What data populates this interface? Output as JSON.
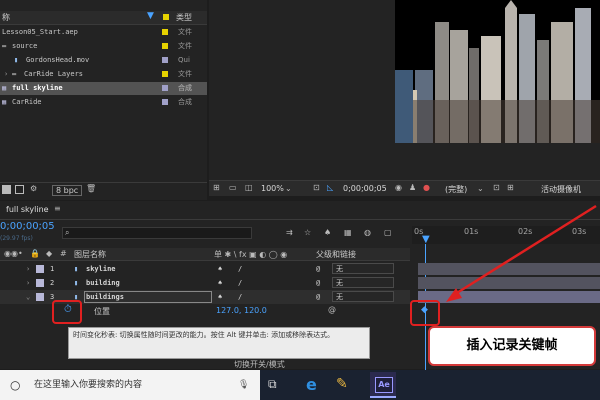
{
  "project": {
    "col_name": "称",
    "col_type": "类型",
    "items": [
      {
        "name": "Lesson05_Start.aep",
        "type": "文件",
        "label_color": "#e6d200",
        "indent": 0
      },
      {
        "name": "source",
        "type": "文件",
        "label_color": "#e6d200",
        "indent": 1
      },
      {
        "name": "GordonsHead.mov",
        "type": "Qui",
        "label_color": "#a0a0c8",
        "indent": 2
      },
      {
        "name": "CarRide Layers",
        "type": "文件",
        "label_color": "#e6d200",
        "indent": 1
      },
      {
        "name": "full skyline",
        "type": "合成",
        "label_color": "#a0a0c8",
        "indent": 0,
        "selected": true
      },
      {
        "name": "CarRide",
        "type": "合成",
        "label_color": "#a0a0c8",
        "indent": 0
      }
    ],
    "footer_bpc": "8 bpc"
  },
  "viewer": {
    "zoom": "100%",
    "timecode": "0;00;00;05",
    "quality": "(完整)",
    "camera": "活动摄像机"
  },
  "timeline": {
    "tab_label": "full skyline",
    "current_time": "0;00;00;05",
    "fps": "(29.97 fps)",
    "search_placeholder": "",
    "col_name": "图层名称",
    "col_switches": "单 ✱ \\ fx ▣ ◐ ◯ ◉",
    "col_parent": "父级和链接",
    "layers": [
      {
        "index": "1",
        "name": "skyline",
        "parent": "无"
      },
      {
        "index": "2",
        "name": "building",
        "parent": "无"
      },
      {
        "index": "3",
        "name": "buildings",
        "parent": "无"
      }
    ],
    "property_label": "位置",
    "property_value": "127.0, 120.0",
    "ruler_marks": [
      "0s",
      "01s",
      "02s",
      "03s"
    ],
    "toggle_label": "切换开关/模式"
  },
  "tooltip": "时间变化秒表: 切换属性随时间更改的能力。按住 Alt 键并单击: 添加或移除表达式。",
  "callout": "插入记录关键帧",
  "taskbar": {
    "search_placeholder": "在这里输入你要搜索的内容",
    "app_ae": "Ae"
  }
}
